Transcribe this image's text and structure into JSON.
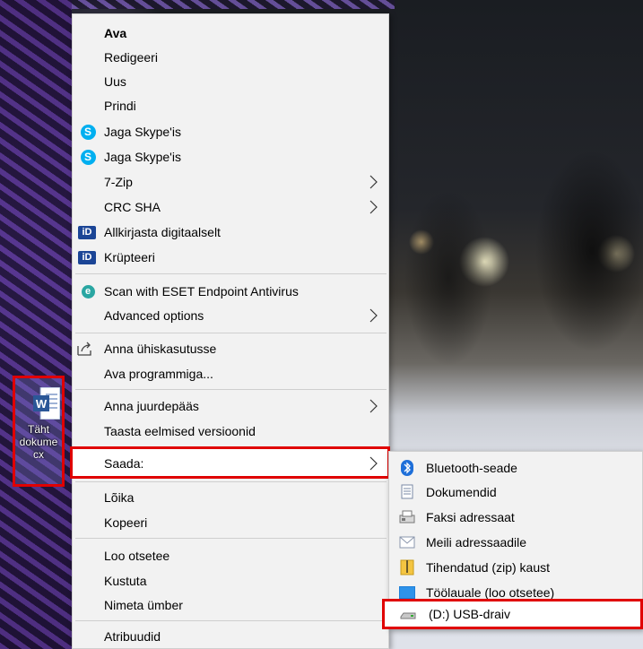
{
  "desktop": {
    "file_icon": {
      "label": "Tähti dokumentti.docx",
      "label_lines": [
        "Täht",
        "dokume",
        "cx"
      ]
    }
  },
  "context_menu": {
    "items": [
      {
        "label": "Ava",
        "icon": null,
        "bold": true
      },
      {
        "label": "Redigeeri",
        "icon": null
      },
      {
        "label": "Uus",
        "icon": null
      },
      {
        "label": "Prindi",
        "icon": null
      },
      {
        "label": "Jaga Skype'is",
        "icon": "skype-icon"
      },
      {
        "label": "Jaga Skype'is",
        "icon": "skype-icon"
      },
      {
        "label": "7-Zip",
        "icon": null,
        "submenu": true
      },
      {
        "label": "CRC SHA",
        "icon": null,
        "submenu": true
      },
      {
        "label": "Allkirjasta digitaalselt",
        "icon": "id-card-icon"
      },
      {
        "label": "Krüpteeri",
        "icon": "id-card-icon"
      },
      {
        "label": "Scan with ESET Endpoint Antivirus",
        "icon": "eset-icon"
      },
      {
        "label": "Advanced options",
        "icon": null,
        "submenu": true
      },
      {
        "label": "Anna ühiskasutusse",
        "icon": "share-icon"
      },
      {
        "label": "Ava programmiga...",
        "icon": null
      },
      {
        "label": "Anna juurdepääs",
        "icon": null,
        "submenu": true
      },
      {
        "label": "Taasta eelmised versioonid",
        "icon": null
      },
      {
        "label": "Saada:",
        "icon": null,
        "submenu": true,
        "highlighted": true
      },
      {
        "label": "Lõika",
        "icon": null
      },
      {
        "label": "Kopeeri",
        "icon": null
      },
      {
        "label": "Loo otsetee",
        "icon": null
      },
      {
        "label": "Kustuta",
        "icon": null
      },
      {
        "label": "Nimeta ümber",
        "icon": null
      },
      {
        "label": "Atribuudid",
        "icon": null
      }
    ]
  },
  "send_to_submenu": {
    "items": [
      {
        "label": "Bluetooth-seade",
        "icon": "bluetooth-icon"
      },
      {
        "label": "Dokumendid",
        "icon": "documents-icon"
      },
      {
        "label": "Faksi adressaat",
        "icon": "fax-icon"
      },
      {
        "label": "Meili adressaadile",
        "icon": "mail-icon"
      },
      {
        "label": "Tihendatud (zip) kaust",
        "icon": "zip-folder-icon"
      },
      {
        "label": "Töölauale (loo otsetee)",
        "icon": "desktop-icon"
      },
      {
        "label": "(D:) USB-draiv",
        "icon": "usb-drive-icon",
        "highlighted": true
      }
    ]
  },
  "colors": {
    "highlight": "#e00000",
    "menu_bg": "#f2f2f2",
    "separator": "#cfcfcf"
  }
}
